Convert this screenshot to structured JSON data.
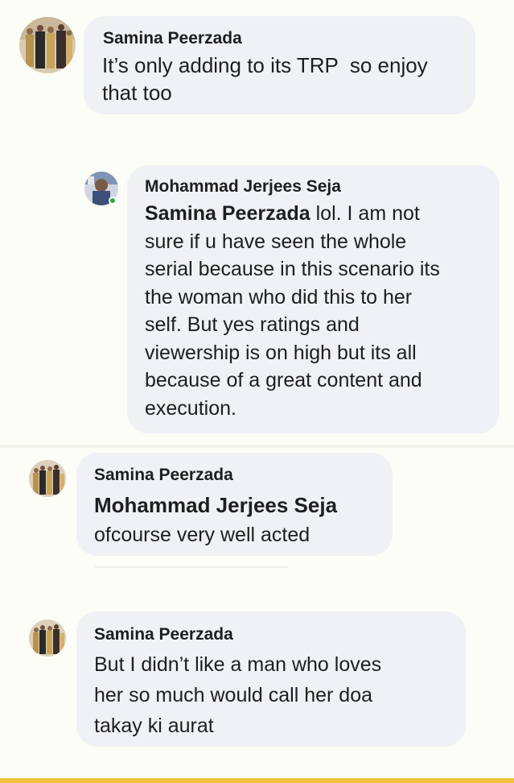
{
  "comments": [
    {
      "author": "Samina Peerzada",
      "mention": "",
      "text_lines": [
        "It’s only adding to its TRP  so enjoy",
        "that too"
      ]
    },
    {
      "author": "Mohammad Jerjees Seja",
      "mention": "Samina Peerzada",
      "first_line_rest": " lol. I am not",
      "text_lines": [
        "sure if u have seen the whole",
        "serial because in this scenario its",
        "the woman who did this to her",
        "self. But yes ratings and",
        "viewership is on high but its all",
        "because of a great content and",
        "execution."
      ],
      "online": true
    },
    {
      "author": "Samina Peerzada",
      "mention": "Mohammad Jerjees Seja",
      "text_lines": [
        "ofcourse very well acted"
      ]
    },
    {
      "author": "Samina Peerzada",
      "mention": "",
      "text_lines": [
        "But I didn’t like a man who loves",
        "her so much would call her doa",
        "takay ki aurat"
      ]
    }
  ],
  "colors": {
    "bubble": "#f0f1f4",
    "background": "#fdfdf7",
    "text": "#1c1e21",
    "online": "#31a24c",
    "bottom_bar": "#f2c443"
  }
}
